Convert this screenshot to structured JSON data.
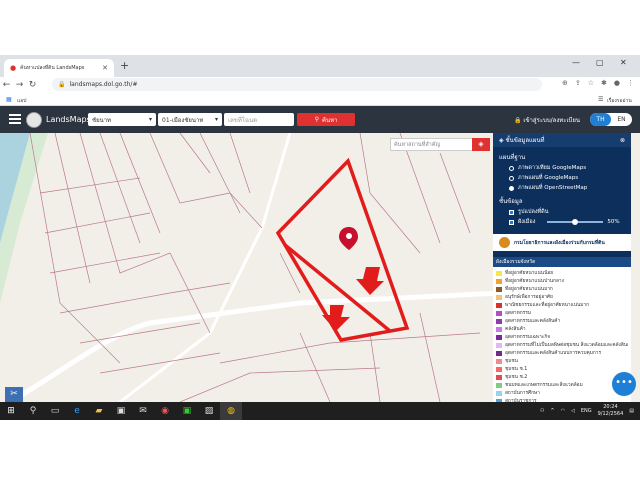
{
  "browser": {
    "tab_title": "ค้นหาแปลงที่ดิน LandsMaps",
    "address": "landsmaps.dol.go.th/#",
    "bookmarks_left": "แอป",
    "bookmarks_right": "เรื่องรออ่าน"
  },
  "app": {
    "brand": "LandsMaps",
    "province": "ชัยนาท",
    "district": "01-เมืองชัยนาท",
    "parcel_placeholder": "เลขที่โฉนด",
    "search_label": "ค้นหา",
    "login_label": "เข้าสู่ระบบ/ลงทะเบียน",
    "lang_th": "TH",
    "lang_en": "EN"
  },
  "map": {
    "place_search_placeholder": "ค้นหาสถานที่สำคัญ"
  },
  "panel": {
    "title": "ชั้นข้อมูลแผนที่",
    "basemap_heading": "แผนที่ฐาน",
    "basemaps": [
      {
        "label": "ภาพดาวเทียม GoogleMaps",
        "selected": false
      },
      {
        "label": "ภาพแผนที่ GoogleMaps",
        "selected": false
      },
      {
        "label": "ภาพแผนที่ OpenStreetMap",
        "selected": true
      }
    ],
    "layers_heading": "ชั้นข้อมูล",
    "layer_parcel": "รูปแปลงที่ดิน",
    "layer_zoning": "ผังเมือง",
    "opacity_percent": "50%",
    "opacity_value": 50,
    "banner": "กรมโยธาธิการและผังเมืองร่วมกับกรมที่ดิน",
    "legend_heading": "ผังเมืองรวมจังหวัด",
    "legend": [
      {
        "label": "ที่อยู่อาศัยหนาแน่นน้อย",
        "color": "#f7e84a"
      },
      {
        "label": "ที่อยู่อาศัยหนาแน่นปานกลาง",
        "color": "#f4a12b"
      },
      {
        "label": "ที่อยู่อาศัยหนาแน่นมาก",
        "color": "#8a5a2b"
      },
      {
        "label": "อนุรักษ์เพื่อการอยู่อาศัย",
        "color": "#f2c27a"
      },
      {
        "label": "พาณิชยกรรมและที่อยู่อาศัยหนาแน่นมาก",
        "color": "#d9312b"
      },
      {
        "label": "อุตสาหกรรม",
        "color": "#b04fc9"
      },
      {
        "label": "อุตสาหกรรมและคลังสินค้า",
        "color": "#8a3fb0"
      },
      {
        "label": "คลังสินค้า",
        "color": "#c77be0"
      },
      {
        "label": "อุตสาหกรรมเฉพาะกิจ",
        "color": "#7a2a9a"
      },
      {
        "label": "อุตสาหกรรมที่ไม่เป็นมลพิษต่อชุมชน สิ่งแวดล้อมและคลังสินค้า",
        "color": "#e7b6f0"
      },
      {
        "label": "อุตสาหกรรมและคลังสินค้าแบบการควบคุมการ",
        "color": "#6e2f84"
      },
      {
        "label": "ชุมชน",
        "color": "#f08c8c"
      },
      {
        "label": "ชุมชน ช.1",
        "color": "#f46a6a"
      },
      {
        "label": "ชุมชน ช.2",
        "color": "#e24c4c"
      },
      {
        "label": "ชนบทและเกษตรกรรมและสิ่งแวดล้อม",
        "color": "#7fcf7f"
      },
      {
        "label": "สถาบันการศึกษา",
        "color": "#9ad0f0"
      },
      {
        "label": "สถาบันราชการ",
        "color": "#5aa0d8"
      }
    ]
  },
  "taskbar": {
    "language": "ENG",
    "time": "20:24",
    "date": "9/12/2564"
  },
  "colors": {
    "header": "#2c3440",
    "panel": "#0c2f5c",
    "accent": "#e03131",
    "annotation": "#e21b1b"
  }
}
